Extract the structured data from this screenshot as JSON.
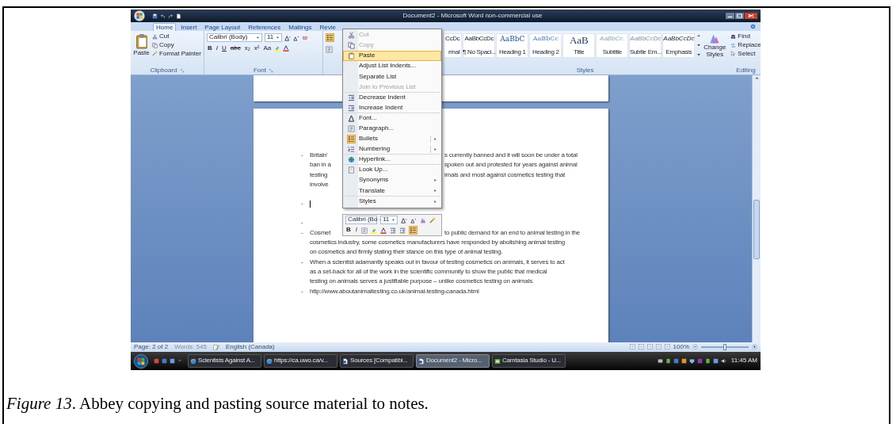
{
  "title_bar": {
    "title": "Document2 - Microsoft Word non-commercial use"
  },
  "tabs": [
    {
      "label": "Home",
      "selected": true
    },
    {
      "label": "Insert",
      "selected": false
    },
    {
      "label": "Page Layout",
      "selected": false
    },
    {
      "label": "References",
      "selected": false
    },
    {
      "label": "Mailings",
      "selected": false
    },
    {
      "label": "Revie",
      "selected": false
    }
  ],
  "ribbon": {
    "clipboard": {
      "paste": "Paste",
      "cut": "Cut",
      "copy": "Copy",
      "format_painter": "Format Painter",
      "label": "Clipboard"
    },
    "font": {
      "name": "Calibri (Body)",
      "size": "11",
      "format_buttons": [
        "B",
        "I",
        "U",
        "abc",
        "x₂",
        "x²",
        "Aa"
      ],
      "label": "Font"
    },
    "styles": {
      "items": [
        {
          "sample": "CcDc",
          "name": "rmal",
          "kind": "body"
        },
        {
          "sample": "AaBbCcDc",
          "name": "¶ No Spaci...",
          "kind": "body"
        },
        {
          "sample": "AaBbC",
          "name": "Heading 1",
          "kind": "heading1"
        },
        {
          "sample": "AaBbCc",
          "name": "Heading 2",
          "kind": "heading2"
        },
        {
          "sample": "AaB",
          "name": "Title",
          "kind": "title"
        },
        {
          "sample": "AaBbCc.",
          "name": "Subtitle",
          "kind": "subtitle"
        },
        {
          "sample": "AaBbCcDc",
          "name": "Subtle Em...",
          "kind": "subtle"
        },
        {
          "sample": "AaBbCcDc",
          "name": "Emphasis",
          "kind": "emphasis"
        }
      ],
      "label": "Styles"
    },
    "change_styles": "Change Styles",
    "editing": {
      "items": [
        "Find",
        "Replace",
        "Select"
      ],
      "label": "Editing"
    }
  },
  "context_menu": [
    {
      "label": "Cut",
      "disabled": true,
      "selected": false,
      "checked": false,
      "submenu": false,
      "separator_after": false
    },
    {
      "label": "Copy",
      "disabled": true,
      "selected": false,
      "checked": false,
      "submenu": false,
      "separator_after": false
    },
    {
      "label": "Paste",
      "disabled": false,
      "selected": true,
      "checked": false,
      "submenu": false,
      "separator_after": true
    },
    {
      "label": "Adjust List Indents...",
      "disabled": false,
      "selected": false,
      "checked": false,
      "submenu": false,
      "separator_after": false
    },
    {
      "label": "Separate List",
      "disabled": false,
      "selected": false,
      "checked": false,
      "submenu": false,
      "separator_after": false
    },
    {
      "label": "Join to Previous List",
      "disabled": true,
      "selected": false,
      "checked": false,
      "submenu": false,
      "separator_after": true
    },
    {
      "label": "Decrease Indent",
      "disabled": false,
      "selected": false,
      "checked": false,
      "submenu": false,
      "separator_after": false
    },
    {
      "label": "Increase Indent",
      "disabled": false,
      "selected": false,
      "checked": false,
      "submenu": false,
      "separator_after": true
    },
    {
      "label": "Font...",
      "disabled": false,
      "selected": false,
      "checked": false,
      "submenu": false,
      "separator_after": false
    },
    {
      "label": "Paragraph...",
      "disabled": false,
      "selected": false,
      "checked": false,
      "submenu": false,
      "separator_after": false
    },
    {
      "label": "Bullets",
      "disabled": false,
      "selected": false,
      "checked": true,
      "submenu": true,
      "separator_after": false
    },
    {
      "label": "Numbering",
      "disabled": false,
      "selected": false,
      "checked": false,
      "submenu": true,
      "separator_after": true
    },
    {
      "label": "Hyperlink...",
      "disabled": false,
      "selected": false,
      "checked": false,
      "submenu": false,
      "separator_after": true
    },
    {
      "label": "Look Up...",
      "disabled": false,
      "selected": false,
      "checked": false,
      "submenu": false,
      "separator_after": false
    },
    {
      "label": "Synonyms",
      "disabled": false,
      "selected": false,
      "checked": false,
      "submenu": true,
      "separator_after": false
    },
    {
      "label": "Translate",
      "disabled": false,
      "selected": false,
      "checked": false,
      "submenu": true,
      "separator_after": true
    },
    {
      "label": "Styles",
      "disabled": false,
      "selected": false,
      "checked": false,
      "submenu": true,
      "separator_after": false
    }
  ],
  "mini_toolbar": {
    "font": "Calibri (Bo",
    "size": "11",
    "bold": "B",
    "italic": "I",
    "bullets_active": true
  },
  "document": {
    "paragraphs": [
      {
        "marker": "-",
        "caret": false,
        "lines": [
          {
            "left": "Britain'",
            "right": "s currently banned and it will soon be under a total"
          },
          {
            "left": "ban in a",
            "right": "spoken out and protested for years against animal"
          },
          {
            "left": "testing",
            "right": "imals and most against cosmetics testing that"
          },
          {
            "left": "involve"
          }
        ]
      },
      {
        "marker": "-",
        "caret": true
      },
      {
        "marker": "-",
        "caret": false
      },
      {
        "marker": "-",
        "caret": false,
        "lines": [
          {
            "left": "Cosmet",
            "right": "to public demand for an end to animal testing in the"
          },
          {
            "left": "cosmetics industry, some cosmetics manufacturers have responded by abolishing animal testing"
          },
          {
            "left": "on cosmetics and firmly stating their stance on this type of animal testing."
          }
        ]
      },
      {
        "marker": "-",
        "caret": false,
        "lines": [
          {
            "left": "When a scientist adamantly speaks out in favour of testing cosmetics on animals, it serves to act"
          },
          {
            "left": "as a set-back for all  of the work in the scientific community to show the public that medical"
          },
          {
            "left": "testing on animals serves a justifiable purpose – unlike cosmetics testing on animals."
          }
        ]
      },
      {
        "marker": "-",
        "caret": false,
        "lines": [
          {
            "left": "http://www.aboutanimaltesting.co.uk/animal-testing-canada.html"
          }
        ]
      }
    ]
  },
  "status_bar": {
    "page": "Page: 2 of 2",
    "words": "Words: 545",
    "language": "English (Canada)",
    "zoom": "100%",
    "zoom_slider": {
      "level": 0.5
    }
  },
  "taskbar": {
    "tasks": [
      {
        "label": "Scientists Against A...",
        "selected": false
      },
      {
        "label": "https://ca.uwo.ca/v...",
        "selected": false
      },
      {
        "label": "Sources [Compatibi...",
        "selected": false
      },
      {
        "label": "Document2 - Micro...",
        "selected": true
      },
      {
        "label": "Camtasia Studio - U...",
        "selected": false
      }
    ],
    "time": "11:45 AM"
  },
  "caption": "*Figure 13*. Abbey copying and pasting source material to notes."
}
